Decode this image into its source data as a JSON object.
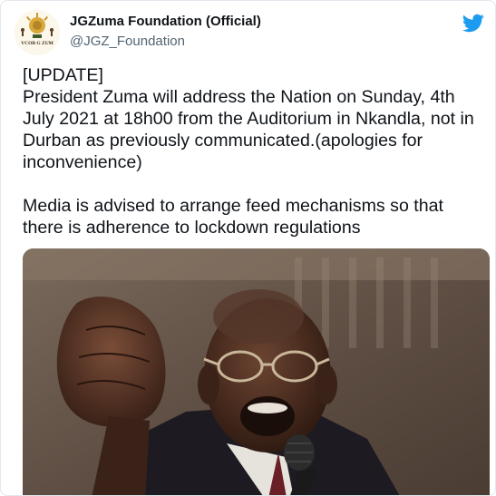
{
  "account": {
    "display_name": "JGZuma Foundation (Official)",
    "handle": "@JGZ_Foundation",
    "avatar_icon": "foundation-logo-icon",
    "avatar_text": "VCOB G ZUM"
  },
  "platform_icon": "twitter-bird-icon",
  "tweet": {
    "lines": [
      "[UPDATE]",
      "President Zuma will address the Nation on Sunday, 4th",
      "July 2021 at 18h00 from the Auditorium in Nkandla, not in",
      "Durban as previously communicated.(apologies for",
      "inconvenience)"
    ],
    "lines2": [
      "Media is advised to arrange feed mechanisms so that",
      "there is adherence to lockdown regulations"
    ]
  },
  "media": {
    "icon": "speaker-photo"
  },
  "colors": {
    "twitter_blue": "#1d9bf0",
    "handle_gray": "#536471",
    "text": "#0f1419"
  }
}
